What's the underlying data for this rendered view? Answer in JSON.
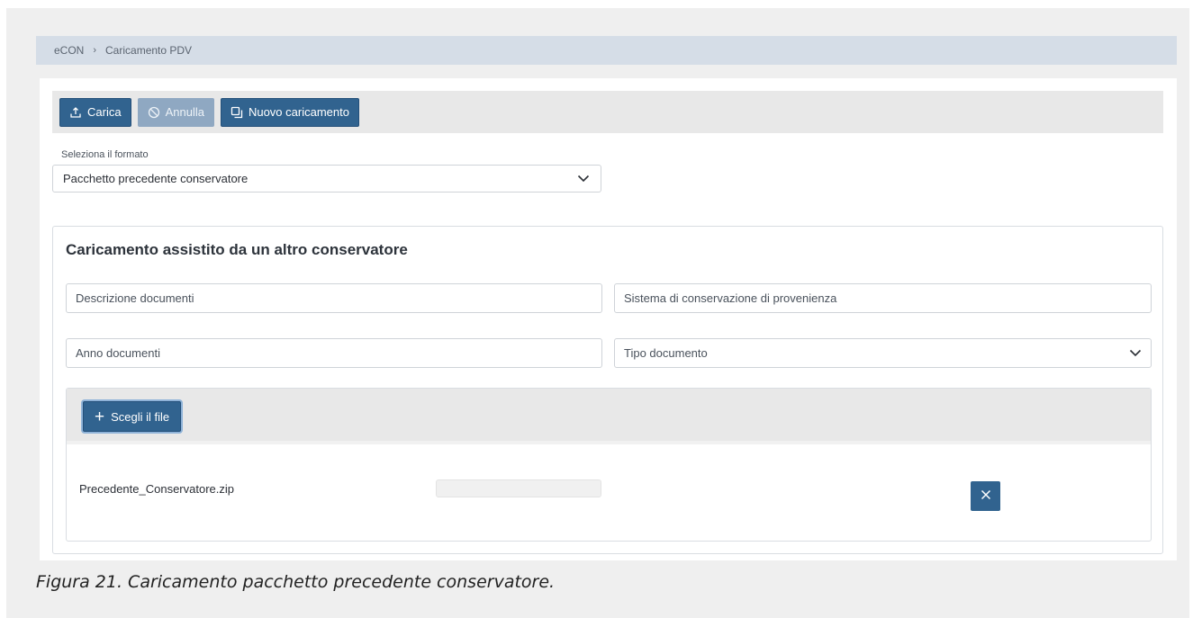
{
  "breadcrumb": {
    "root": "eCON",
    "separator": "›",
    "current": "Caricamento PDV"
  },
  "toolbar": {
    "upload": {
      "label": "Carica",
      "icon": "upload-icon"
    },
    "cancel": {
      "label": "Annulla",
      "icon": "cancel-icon",
      "disabled": true
    },
    "new_upload": {
      "label": "Nuovo caricamento",
      "icon": "copy-icon"
    }
  },
  "format": {
    "label": "Seleziona il formato",
    "selected": "Pacchetto precedente conservatore"
  },
  "form": {
    "title": "Caricamento assistito da un altro conservatore",
    "descrizione_placeholder": "Descrizione documenti",
    "sistema_placeholder": "Sistema di conservazione di provenienza",
    "anno_placeholder": "Anno documenti",
    "tipo_placeholder": "Tipo documento"
  },
  "upload": {
    "choose_label": "Scegli il file",
    "file_name": "Precedente_Conservatore.zip",
    "progress": 0
  },
  "caption": "Figura 21. Caricamento pacchetto precedente conservatore.",
  "colors": {
    "primary": "#31638f",
    "disabled": "#8fa8c2",
    "breadcrumb_bg": "#d5dde7"
  }
}
